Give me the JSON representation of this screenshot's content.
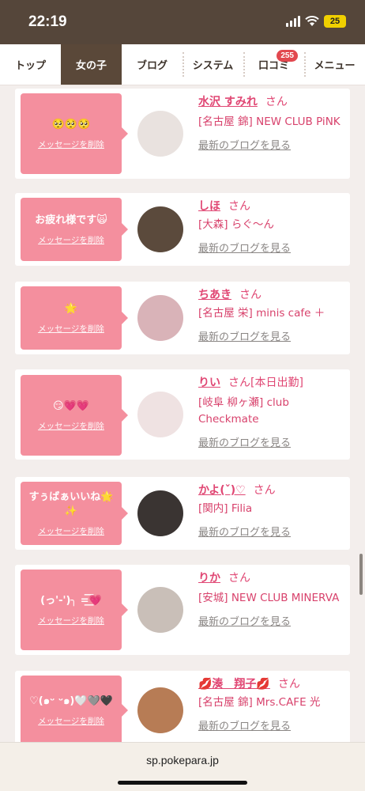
{
  "status": {
    "time": "22:19",
    "battery": "25"
  },
  "nav": {
    "items": [
      {
        "label": "トップ",
        "active": false
      },
      {
        "label": "女の子",
        "active": true
      },
      {
        "label": "ブログ",
        "active": false
      },
      {
        "label": "システム",
        "active": false
      },
      {
        "label": "口コミ",
        "active": false,
        "badge": "255"
      },
      {
        "label": "メニュー",
        "active": false
      }
    ]
  },
  "messages": [
    {
      "message": "🥺🥺🥺",
      "delete_label": "メッセージを削除",
      "name": "水沢 すみれ",
      "suffix": "さん",
      "shop": "[名古屋 錦] NEW CLUB PiNK",
      "blog_link": "最新のブログを見る",
      "avatar_color": "#e9e2df"
    },
    {
      "message": "お疲れ様です🙀",
      "delete_label": "メッセージを削除",
      "name": "しほ",
      "suffix": "さん",
      "shop": "[大森] らぐ〜ん",
      "blog_link": "最新のブログを見る",
      "avatar_color": "#5b4a3c"
    },
    {
      "message": "🌟",
      "delete_label": "メッセージを削除",
      "name": "ちあき",
      "suffix": "さん",
      "shop": "[名古屋 栄] minis cafe ＋",
      "blog_link": "最新のブログを見る",
      "avatar_color": "#d9b3b8"
    },
    {
      "message": "😏💗💗",
      "delete_label": "メッセージを削除",
      "name": "りい",
      "suffix": "さん[本日出勤]",
      "shop": "[岐阜 柳ヶ瀬] club Checkmate",
      "blog_link": "最新のブログを見る",
      "avatar_color": "#efe2e2"
    },
    {
      "message": "すぅばぁいいね🌟✨",
      "delete_label": "メッセージを削除",
      "name": "かよ(ˇ)♡",
      "suffix": "さん",
      "shop": "[関内] Filia",
      "blog_link": "最新のブログを見る",
      "avatar_color": "#3a3432"
    },
    {
      "message": "(っ'-')╮ =͟͟͞͞💗",
      "delete_label": "メッセージを削除",
      "name": "りか",
      "suffix": "さん",
      "shop": "[安城] NEW CLUB MINERVA",
      "blog_link": "最新のブログを見る",
      "avatar_color": "#c9bfb8"
    },
    {
      "message": "♡(๑ᵕ ᵕ๑)🤍🩶🖤",
      "delete_label": "メッセージを削除",
      "name": "💋湊　翔子💋",
      "suffix": "さん",
      "shop": "[名古屋 錦] Mrs.CAFE 光",
      "blog_link": "最新のブログを見る",
      "avatar_color": "#b77c55"
    }
  ],
  "browser": {
    "url": "sp.pokepara.jp"
  }
}
